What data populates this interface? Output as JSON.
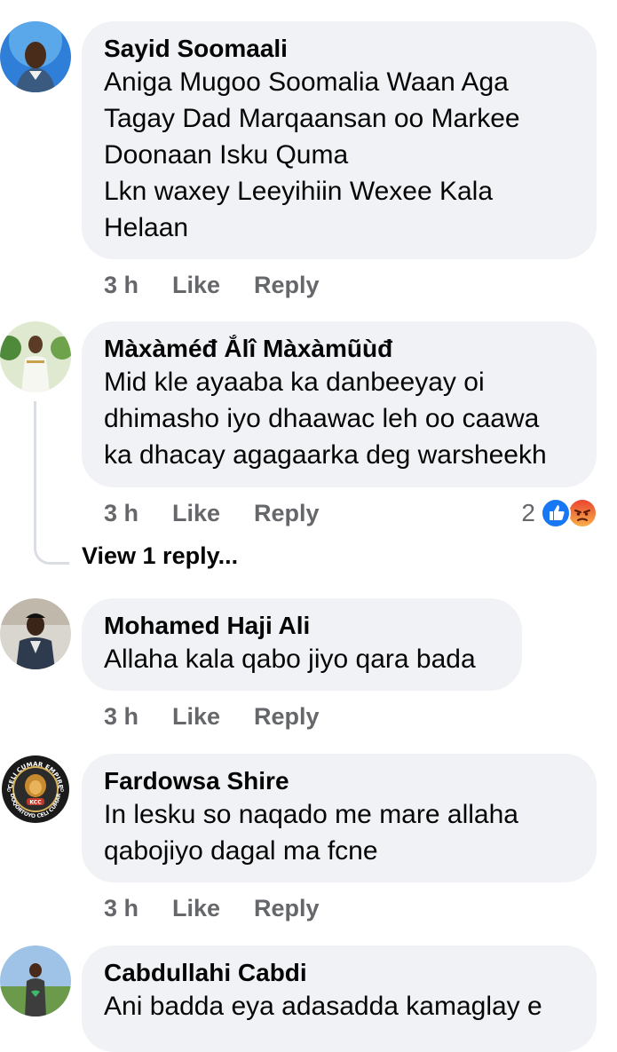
{
  "comments": [
    {
      "author": "Sayid Soomaali",
      "text": "Aniga Mugoo Soomalia Waan  Aga\nTagay  Dad Marqaansan  oo Markee\nDoonaan Isku Quma\nLkn waxey  Leeyihiin Wexee Kala\nHelaan",
      "time": "3 h",
      "like_label": "Like",
      "reply_label": "Reply"
    },
    {
      "author": "Màxàméđ Ắlî Màxàmũùđ",
      "text": "Mid kle ayaaba ka danbeeyay oi\ndhimasho iyo dhaawac leh oo caawa\nka dhacay agagaarka deg warsheekh",
      "time": "3 h",
      "like_label": "Like",
      "reply_label": "Reply",
      "reaction_count": "2",
      "reactions": [
        "like-icon",
        "angry-icon"
      ],
      "view_replies_label": "View 1 reply..."
    },
    {
      "author": "Mohamed Haji Ali",
      "text": "Allaha kala qabo jiyo  qara bada",
      "time": "3 h",
      "like_label": "Like",
      "reply_label": "Reply"
    },
    {
      "author": "Fardowsa Shire",
      "text": "In lesku so naqado me mare allaha\nqabojiyo dagal ma fcne",
      "time": "3 h",
      "like_label": "Like",
      "reply_label": "Reply",
      "avatar_logo": {
        "top_text": "CELI CUMAR EMPIRE",
        "bottom_text": "DOQORTOYO CELI CUMAR",
        "badge": "KCC",
        "side_number": "6"
      }
    },
    {
      "author": "Cabdullahi Cabdi",
      "text": "Ani badda eya adasadda kamaglay e"
    }
  ],
  "colors": {
    "bubble": "#f0f2f5",
    "meta_text": "#65676b",
    "like_blue": "#1877f2",
    "angry_orange": "#f7714c"
  }
}
